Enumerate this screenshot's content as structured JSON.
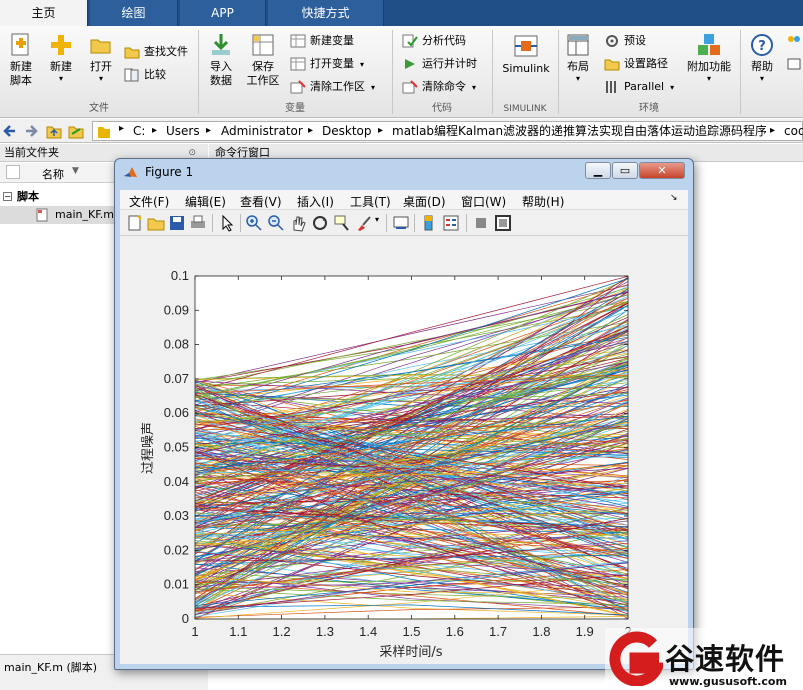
{
  "tabs": [
    "主页",
    "绘图",
    "APP",
    "快捷方式"
  ],
  "ribbon": {
    "file": {
      "new_script": "新建\n脚本",
      "new": "新建",
      "open": "打开",
      "find_files": "查找文件",
      "compare": "比较",
      "section": "文件"
    },
    "variable": {
      "import": "导入\n数据",
      "save_ws": "保存\n工作区",
      "new_var": "新建变量",
      "open_var": "打开变量",
      "clear_ws": "清除工作区",
      "section": "变量"
    },
    "code": {
      "analyze": "分析代码",
      "run_time": "运行并计时",
      "clear_cmd": "清除命令",
      "section": "代码"
    },
    "simulink": {
      "label": "Simulink",
      "section": "SIMULINK"
    },
    "env": {
      "layout": "布局",
      "prefs": "预设",
      "set_path": "设置路径",
      "parallel": "Parallel",
      "addons": "附加功能",
      "section": "环境"
    },
    "help": "帮助"
  },
  "address": {
    "crumbs": [
      "C:",
      "Users",
      "Administrator",
      "Desktop",
      "matlab编程Kalman滤波器的递推算法实现自由落体运动追踪源码程序",
      "cod"
    ]
  },
  "left_panel": {
    "title": "当前文件夹",
    "col_name": "名称",
    "group": "脚本",
    "file": "main_KF.m",
    "footer": "main_KF.m  (脚本)"
  },
  "cmd": {
    "title": "命令行窗口"
  },
  "figure": {
    "title": "Figure 1",
    "menu": [
      "文件(F)",
      "编辑(E)",
      "查看(V)",
      "插入(I)",
      "工具(T)",
      "桌面(D)",
      "窗口(W)",
      "帮助(H)"
    ]
  },
  "chart_data": {
    "type": "line",
    "xlabel": "采样时间/s",
    "ylabel": "过程噪声",
    "xlim": [
      1,
      2
    ],
    "ylim": [
      0,
      0.1
    ],
    "xticks": [
      1,
      1.1,
      1.2,
      1.3,
      1.4,
      1.5,
      1.6,
      1.7,
      1.8,
      1.9,
      2
    ],
    "xtick_labels": [
      "1",
      "1.1",
      "1.2",
      "1.3",
      "1.4",
      "1.5",
      "1.6",
      "1.7",
      "1.8",
      "1.9",
      "2"
    ],
    "yticks": [
      0,
      0.01,
      0.02,
      0.03,
      0.04,
      0.05,
      0.06,
      0.07,
      0.08,
      0.09,
      0.1
    ],
    "ytick_labels": [
      "0",
      "0.01",
      "0.02",
      "0.03",
      "0.04",
      "0.05",
      "0.06",
      "0.07",
      "0.08",
      "0.09",
      "0.1"
    ],
    "grid": false,
    "series_count": 400,
    "series_x": [
      1,
      1.5,
      2
    ],
    "start_range": [
      0,
      0.07
    ],
    "end_range": [
      0,
      0.1
    ],
    "colors": [
      "#0072bd",
      "#d95319",
      "#edb120",
      "#7e2f8e",
      "#77ac30",
      "#4dbeee",
      "#a2142f"
    ]
  },
  "watermark": {
    "brand": "谷速软件",
    "url": "www.gususoft.com"
  },
  "colors": {
    "matlab_blue": "#1f4f86",
    "watermark_red": "#d61d1d"
  }
}
